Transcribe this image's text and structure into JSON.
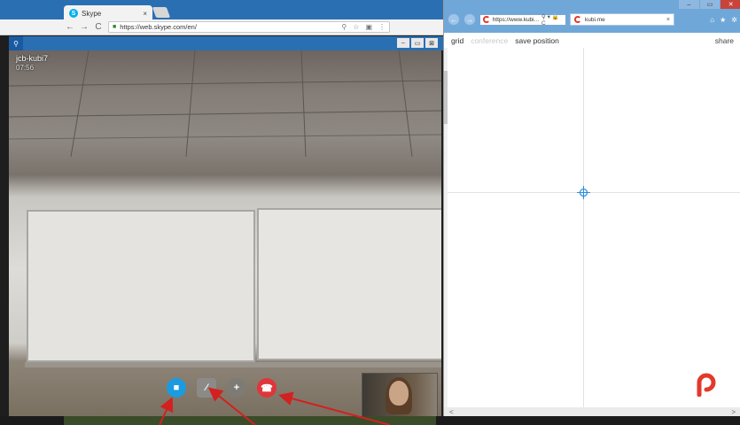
{
  "left_window": {
    "tab_title": "Skype",
    "tab_close": "×",
    "nav": {
      "back": "←",
      "forward": "→",
      "reload": "C"
    },
    "url": "https://web.skype.com/en/",
    "url_icons": [
      "key-icon",
      "star-icon",
      "extension-icon",
      "menu-icon"
    ],
    "url_icon_glyphs": [
      "⚲",
      "☆",
      "▣",
      "⋮"
    ],
    "skype_bar_glyph": "⚲",
    "window_controls": [
      "–",
      "▭",
      "⊠"
    ]
  },
  "call": {
    "contact_name": "jcb-kubi7",
    "timer": "07:56",
    "buttons": {
      "video": {
        "icon": "video-camera-icon",
        "glyph": "■"
      },
      "mic": {
        "icon": "microphone-muted-icon",
        "glyph": "⁄"
      },
      "add": {
        "icon": "plus-icon",
        "glyph": "+"
      },
      "hangup": {
        "icon": "phone-hangup-icon",
        "glyph": "☎"
      }
    }
  },
  "right_window": {
    "window_controls": [
      "–",
      "▭",
      "✕"
    ],
    "nav": {
      "back": "←",
      "forward": "→"
    },
    "address": "https://www.kubi...",
    "address_controls": "⚲ ▾ 🔒 C",
    "tab_title": "kubi.me",
    "tab_close": "×",
    "toolbar_icons": [
      "home-icon",
      "star-icon",
      "gear-icon"
    ],
    "toolbar_glyphs": [
      "⌂",
      "★",
      "✲"
    ],
    "menu": {
      "grid": "grid",
      "conference": "conference",
      "save_position": "save position",
      "share": "share"
    },
    "scroll_left": "<",
    "scroll_right": ">"
  },
  "colors": {
    "skype_blue": "#1b9be0",
    "hangup_red": "#e0353b",
    "kubi_red": "#e23a2a",
    "chrome_frame_blue": "#2b6fb3"
  }
}
